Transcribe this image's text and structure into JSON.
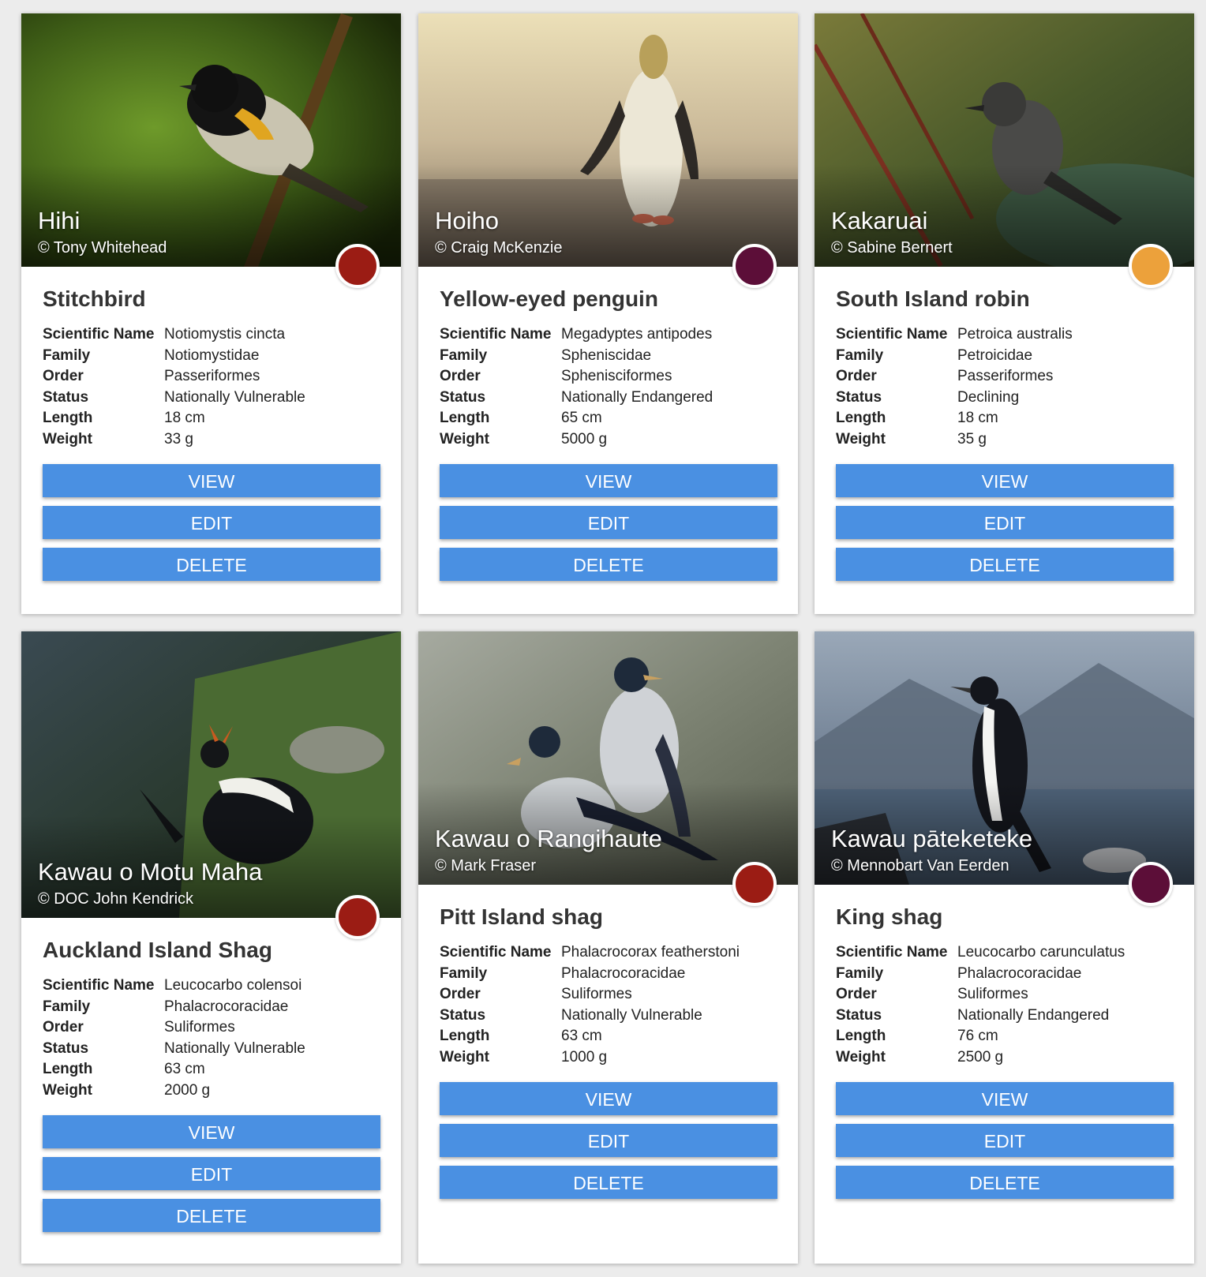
{
  "buttons": {
    "view": "VIEW",
    "edit": "EDIT",
    "delete": "DELETE"
  },
  "labels": {
    "scientific_name": "Scientific Name",
    "family": "Family",
    "order": "Order",
    "status": "Status",
    "length": "Length",
    "weight": "Weight"
  },
  "birds": [
    {
      "primary_name": "Hihi",
      "credit": "© Tony Whitehead",
      "english_name": "Stitchbird",
      "scientific_name": "Notiomystis cincta",
      "family": "Notiomystidae",
      "order": "Passeriformes",
      "status": "Nationally Vulnerable",
      "length": "18 cm",
      "weight": "33 g",
      "status_color": "#9b1c14"
    },
    {
      "primary_name": "Hoiho",
      "credit": "© Craig McKenzie",
      "english_name": "Yellow-eyed penguin",
      "scientific_name": "Megadyptes antipodes",
      "family": "Spheniscidae",
      "order": "Sphenisciformes",
      "status": "Nationally Endangered",
      "length": "65 cm",
      "weight": "5000 g",
      "status_color": "#5c0e38"
    },
    {
      "primary_name": "Kakaruai",
      "credit": "© Sabine Bernert",
      "english_name": "South Island robin",
      "scientific_name": "Petroica australis",
      "family": "Petroicidae",
      "order": "Passeriformes",
      "status": "Declining",
      "length": "18 cm",
      "weight": "35 g",
      "status_color": "#eca13b"
    },
    {
      "primary_name": "Kawau o Motu Maha",
      "credit": "© DOC John Kendrick",
      "english_name": "Auckland Island Shag",
      "scientific_name": "Leucocarbo colensoi",
      "family": "Phalacrocoracidae",
      "order": "Suliformes",
      "status": "Nationally Vulnerable",
      "length": "63 cm",
      "weight": "2000 g",
      "status_color": "#9b1c14"
    },
    {
      "primary_name": "Kawau o Rangihaute",
      "credit": "© Mark Fraser",
      "english_name": "Pitt Island shag",
      "scientific_name": "Phalacrocorax featherstoni",
      "family": "Phalacrocoracidae",
      "order": "Suliformes",
      "status": "Nationally Vulnerable",
      "length": "63 cm",
      "weight": "1000 g",
      "status_color": "#9b1c14"
    },
    {
      "primary_name": "Kawau pāteketeke",
      "credit": "© Mennobart Van Eerden",
      "english_name": "King shag",
      "scientific_name": "Leucocarbo carunculatus",
      "family": "Phalacrocoracidae",
      "order": "Suliformes",
      "status": "Nationally Endangered",
      "length": "76 cm",
      "weight": "2500 g",
      "status_color": "#5c0e38"
    }
  ]
}
